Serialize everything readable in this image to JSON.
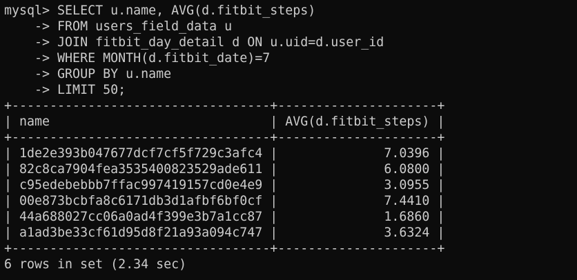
{
  "terminal": {
    "prompt": "mysql> ",
    "continuation": "    -> ",
    "query_lines": [
      "SELECT u.name, AVG(d.fitbit_steps)",
      "FROM users_field_data u",
      "JOIN fitbit_day_detail d ON u.uid=d.user_id",
      "WHERE MONTH(d.fitbit_date)=7",
      "GROUP BY u.name",
      "LIMIT 50;"
    ],
    "result": {
      "columns": [
        "name",
        "AVG(d.fitbit_steps)"
      ],
      "rows": [
        [
          "1de2e393b047677dcf7cf5f729c3afc4",
          "7.0396"
        ],
        [
          "82c8ca7904fea3535400823529ade611",
          "6.0800"
        ],
        [
          "c95edebebbb7ffac997419157cd0e4e9",
          "3.0955"
        ],
        [
          "00e873bcbfa8c6171db3d1afbf6bf0cf",
          "7.4410"
        ],
        [
          "44a688027cc06a0ad4f399e3b7a1cc87",
          "1.6860"
        ],
        [
          "a1ad3be33cf61d95d8f21a93a094c747",
          "3.6324"
        ]
      ]
    },
    "status": "6 rows in set (2.34 sec)"
  }
}
